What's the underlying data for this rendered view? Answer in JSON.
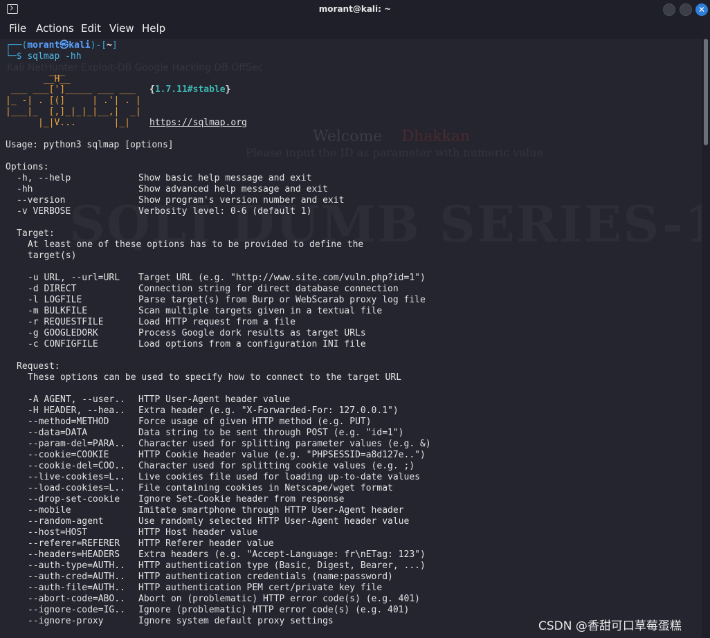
{
  "window": {
    "title": "morant@kali: ~",
    "close_glyph": "✕"
  },
  "menu": [
    "File",
    "Actions",
    "Edit",
    "View",
    "Help"
  ],
  "background_ghost": {
    "tabs": "Kali NetHunter   Exploit-DB   Google Hacking DB   OffSec",
    "welcome": "Welcome",
    "welcome_name": "Dhakkan",
    "subtitle": "Please input the ID as parameter with numeric value",
    "banner": "SQLI DUMB SERIES-1"
  },
  "prompt": {
    "frame_top": "┌──(",
    "user": "morant㉿kali",
    "frame_mid": ")-[",
    "dir": "~",
    "frame_end": "]",
    "frame_bottom": "└─$ ",
    "command": "sqlmap -hh"
  },
  "logo": {
    "lines": [
      "        ___",
      "       __H__",
      " ___ ___[']_____ ___ ___",
      "|_ -| . [(]     | .'| . |",
      "|___|_  [,]_|_|_|__,|  _|",
      "      |_|V...       |_|"
    ],
    "version": "1.7.11#stable",
    "url": "https://sqlmap.org"
  },
  "usage": "Usage: python3 sqlmap [options]",
  "sections": {
    "options_header": "Options:",
    "options": [
      {
        "opt": "-h, --help",
        "desc": "Show basic help message and exit"
      },
      {
        "opt": "-hh",
        "desc": "Show advanced help message and exit"
      },
      {
        "opt": "--version",
        "desc": "Show program's version number and exit"
      },
      {
        "opt": "-v VERBOSE",
        "desc": "Verbosity level: 0-6 (default 1)"
      }
    ],
    "target_header": "Target:",
    "target_note_1": "At least one of these options has to be provided to define the",
    "target_note_2": "target(s)",
    "target": [
      {
        "opt": "-u URL, --url=URL",
        "desc": "Target URL (e.g. \"http://www.site.com/vuln.php?id=1\")"
      },
      {
        "opt": "-d DIRECT",
        "desc": "Connection string for direct database connection"
      },
      {
        "opt": "-l LOGFILE",
        "desc": "Parse target(s) from Burp or WebScarab proxy log file"
      },
      {
        "opt": "-m BULKFILE",
        "desc": "Scan multiple targets given in a textual file"
      },
      {
        "opt": "-r REQUESTFILE",
        "desc": "Load HTTP request from a file"
      },
      {
        "opt": "-g GOOGLEDORK",
        "desc": "Process Google dork results as target URLs"
      },
      {
        "opt": "-c CONFIGFILE",
        "desc": "Load options from a configuration INI file"
      }
    ],
    "request_header": "Request:",
    "request_note": "These options can be used to specify how to connect to the target URL",
    "request": [
      {
        "opt": "-A AGENT, --user..",
        "desc": "HTTP User-Agent header value"
      },
      {
        "opt": "-H HEADER, --hea..",
        "desc": "Extra header (e.g. \"X-Forwarded-For: 127.0.0.1\")"
      },
      {
        "opt": "--method=METHOD",
        "desc": "Force usage of given HTTP method (e.g. PUT)"
      },
      {
        "opt": "--data=DATA",
        "desc": "Data string to be sent through POST (e.g. \"id=1\")"
      },
      {
        "opt": "--param-del=PARA..",
        "desc": "Character used for splitting parameter values (e.g. &)"
      },
      {
        "opt": "--cookie=COOKIE",
        "desc": "HTTP Cookie header value (e.g. \"PHPSESSID=a8d127e..\")"
      },
      {
        "opt": "--cookie-del=COO..",
        "desc": "Character used for splitting cookie values (e.g. ;)"
      },
      {
        "opt": "--live-cookies=L..",
        "desc": "Live cookies file used for loading up-to-date values"
      },
      {
        "opt": "--load-cookies=L..",
        "desc": "File containing cookies in Netscape/wget format"
      },
      {
        "opt": "--drop-set-cookie",
        "desc": "Ignore Set-Cookie header from response"
      },
      {
        "opt": "--mobile",
        "desc": "Imitate smartphone through HTTP User-Agent header"
      },
      {
        "opt": "--random-agent",
        "desc": "Use randomly selected HTTP User-Agent header value"
      },
      {
        "opt": "--host=HOST",
        "desc": "HTTP Host header value"
      },
      {
        "opt": "--referer=REFERER",
        "desc": "HTTP Referer header value"
      },
      {
        "opt": "--headers=HEADERS",
        "desc": "Extra headers (e.g. \"Accept-Language: fr\\nETag: 123\")"
      },
      {
        "opt": "--auth-type=AUTH..",
        "desc": "HTTP authentication type (Basic, Digest, Bearer, ...)"
      },
      {
        "opt": "--auth-cred=AUTH..",
        "desc": "HTTP authentication credentials (name:password)"
      },
      {
        "opt": "--auth-file=AUTH..",
        "desc": "HTTP authentication PEM cert/private key file"
      },
      {
        "opt": "--abort-code=ABO..",
        "desc": "Abort on (problematic) HTTP error code(s) (e.g. 401)"
      },
      {
        "opt": "--ignore-code=IG..",
        "desc": "Ignore (problematic) HTTP error code(s) (e.g. 401)"
      },
      {
        "opt": "--ignore-proxy",
        "desc": "Ignore system default proxy settings"
      }
    ]
  },
  "watermark": "CSDN @香甜可口草莓蛋糕"
}
